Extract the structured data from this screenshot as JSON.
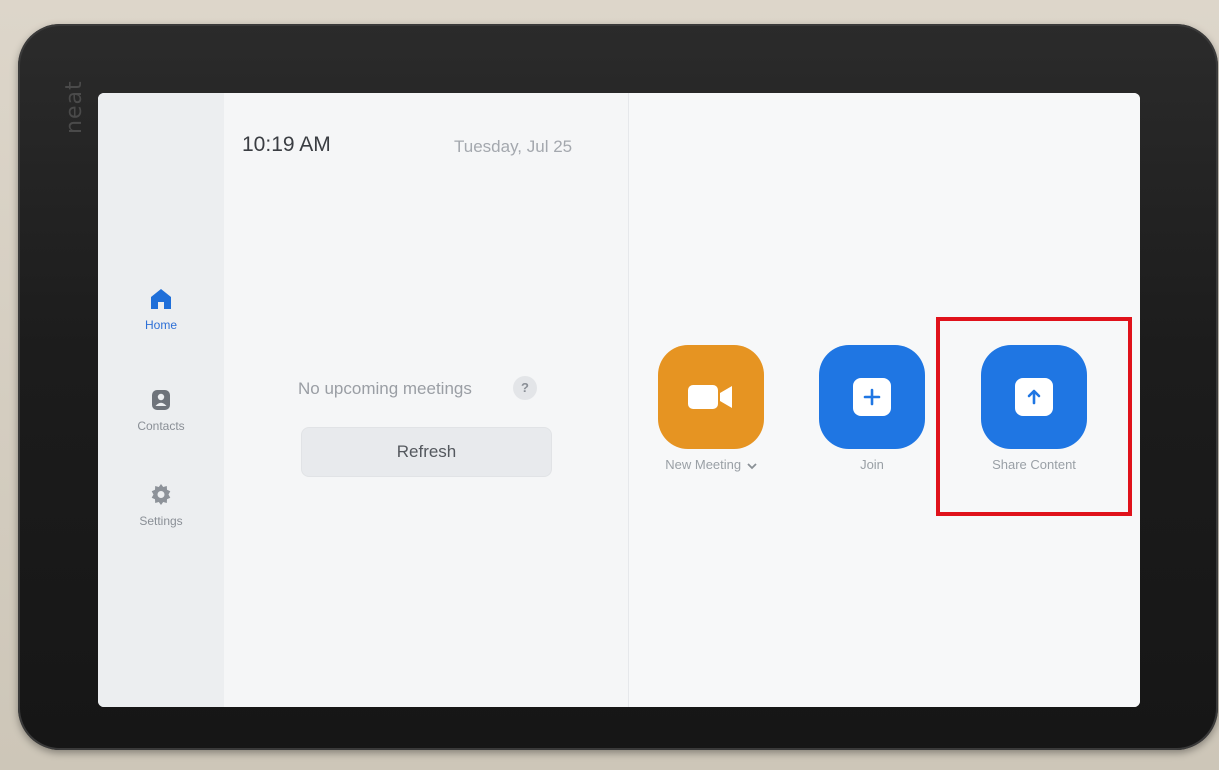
{
  "device": {
    "brand": "neat"
  },
  "status": {
    "time": "10:19 AM",
    "date": "Tuesday, Jul 25"
  },
  "sidebar": {
    "items": [
      {
        "label": "Home",
        "icon": "home-icon",
        "active": true
      },
      {
        "label": "Contacts",
        "icon": "contacts-icon",
        "active": false
      },
      {
        "label": "Settings",
        "icon": "gear-icon",
        "active": false
      }
    ]
  },
  "meetings": {
    "empty_text": "No upcoming meetings",
    "help_label": "?",
    "refresh_label": "Refresh"
  },
  "actions": [
    {
      "label": "New Meeting",
      "icon": "video-camera-icon",
      "color": "#e69422",
      "dropdown_icon": "chevron-down-icon"
    },
    {
      "label": "Join",
      "icon": "plus-icon",
      "color": "#1f76e3"
    },
    {
      "label": "Share Content",
      "icon": "upload-arrow-icon",
      "color": "#1f76e3"
    }
  ],
  "annotation": {
    "highlight_color": "#e0121b",
    "highlight_target": "Share Content"
  },
  "colors": {
    "accent": "#2d6fd6",
    "orange": "#e69422",
    "blue": "#1f76e3"
  }
}
